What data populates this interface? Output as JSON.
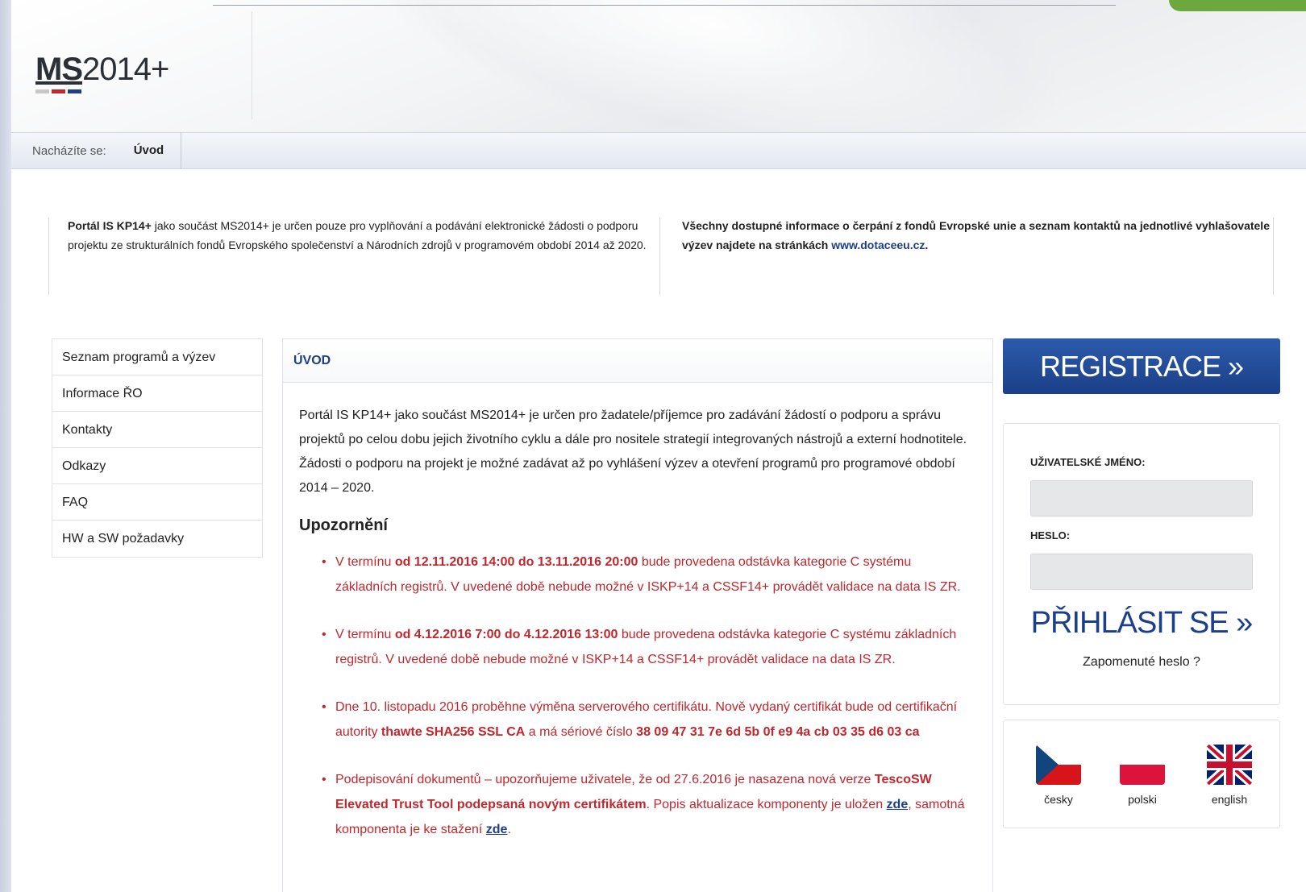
{
  "header": {
    "logo_bold": "MS",
    "logo_rest": "2014+",
    "logo_bar_colors": [
      "#c8c8c8",
      "#c1272d",
      "#1b3f88"
    ]
  },
  "breadcrumb": {
    "label": "Nacházíte se:",
    "current": "Úvod"
  },
  "intro": {
    "left_bold": "Portál IS KP14+",
    "left_text": " jako součást MS2014+ je určen pouze pro vyplňování a podávání elektronické žádosti o podporu projektu ze strukturálních fondů Evropského společenství a Národních zdrojů v programovém období 2014 až 2020.",
    "right_text": "Všechny dostupné informace o čerpání z fondů Evropské unie a seznam kontaktů na jednotlivé vyhlašovatele výzev najdete na stránkách ",
    "right_link": "www.dotaceeu.cz",
    "right_end": "."
  },
  "sidemenu": {
    "items": [
      {
        "label": "Seznam programů a výzev"
      },
      {
        "label": "Informace ŘO"
      },
      {
        "label": "Kontakty"
      },
      {
        "label": "Odkazy"
      },
      {
        "label": "FAQ"
      },
      {
        "label": "HW a SW požadavky"
      }
    ]
  },
  "content": {
    "title": "ÚVOD",
    "paragraph": "Portál IS KP14+ jako součást MS2014+ je určen pro žadatele/příjemce pro zadávání žádostí o podporu a správu projektů po celou dobu jejich životního cyklu a dále pro nositele strategií integrovaných nástrojů a externí hodnotitele. Žádosti o podporu na projekt je možné zadávat až po vyhlášení výzev a otevření programů pro programové období 2014 – 2020.",
    "warning_heading": "Upozornění",
    "notices": [
      {
        "pre": "V termínu ",
        "bold": "od 12.11.2016 14:00 do 13.11.2016 20:00",
        "post": " bude provedena odstávka kategorie C systému základních registrů. V uvedené době nebude možné v ISKP+14 a CSSF14+ provádět validace na data IS ZR."
      },
      {
        "pre": "V termínu ",
        "bold": "od 4.12.2016 7:00 do 4.12.2016 13:00",
        "post": " bude provedena odstávka kategorie C systému základních registrů. V uvedené době nebude možné v ISKP+14 a CSSF14+ provádět validace na data IS ZR."
      },
      {
        "pre": "Dne 10. listopadu 2016 proběhne výměna serverového certifikátu. Nově vydaný certifikát bude od certifikační autority ",
        "bold": "thawte SHA256 SSL CA",
        "mid": " a má sériové číslo ",
        "bold2": "38 09 47 31 7e 6d 5b 0f e9 4a cb 03 35 d6 03 ca"
      },
      {
        "pre": "Podepisování dokumentů – upozorňujeme uživatele, že od 27.6.2016 je nasazena nová verze ",
        "bold": "TescoSW Elevated Trust Tool podepsaná novým certifikátem",
        "mid": ". Popis aktualizace komponenty je uložen ",
        "link1": "zde",
        "mid2": ", samotná komponenta je ke stažení ",
        "link2": "zde",
        "end": "."
      }
    ]
  },
  "register": {
    "label": "REGISTRACE »"
  },
  "login": {
    "username_label": "UŽIVATELSKÉ JMÉNO:",
    "username_value": "",
    "password_label": "HESLO:",
    "password_value": "",
    "submit_label": "PŘIHLÁSIT SE »",
    "forgot_label": "Zapomenuté heslo ?"
  },
  "languages": [
    {
      "label": "česky",
      "icon": "czech-flag-icon"
    },
    {
      "label": "polski",
      "icon": "polish-flag-icon"
    },
    {
      "label": "english",
      "icon": "uk-flag-icon"
    }
  ],
  "colors": {
    "brand_blue": "#1b3f88",
    "warning_red": "#c1272d",
    "accent_green": "#6ca83e"
  }
}
